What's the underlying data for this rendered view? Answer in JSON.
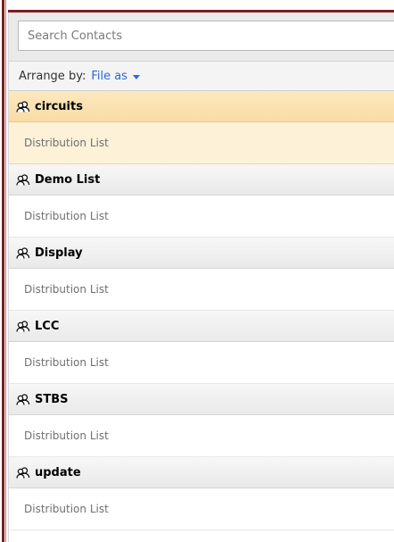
{
  "search": {
    "placeholder": "Search Contacts"
  },
  "arrange": {
    "label": "Arrange by:",
    "value": "File as"
  },
  "contacts": [
    {
      "name": "circuits",
      "type": "Distribution List",
      "selected": true
    },
    {
      "name": "Demo List",
      "type": "Distribution List",
      "selected": false
    },
    {
      "name": "Display",
      "type": "Distribution List",
      "selected": false
    },
    {
      "name": "LCC",
      "type": "Distribution List",
      "selected": false
    },
    {
      "name": "STBS",
      "type": "Distribution List",
      "selected": false
    },
    {
      "name": "update",
      "type": "Distribution List",
      "selected": false
    }
  ],
  "colors": {
    "accent": "#2a6ad8",
    "selected_header": "#fde8bf",
    "selected_row": "#fdf1d8",
    "frame": "#7a1f1f"
  },
  "icons": {
    "list_item": "distribution-list-icon",
    "arrange_caret": "chevron-down-icon"
  }
}
